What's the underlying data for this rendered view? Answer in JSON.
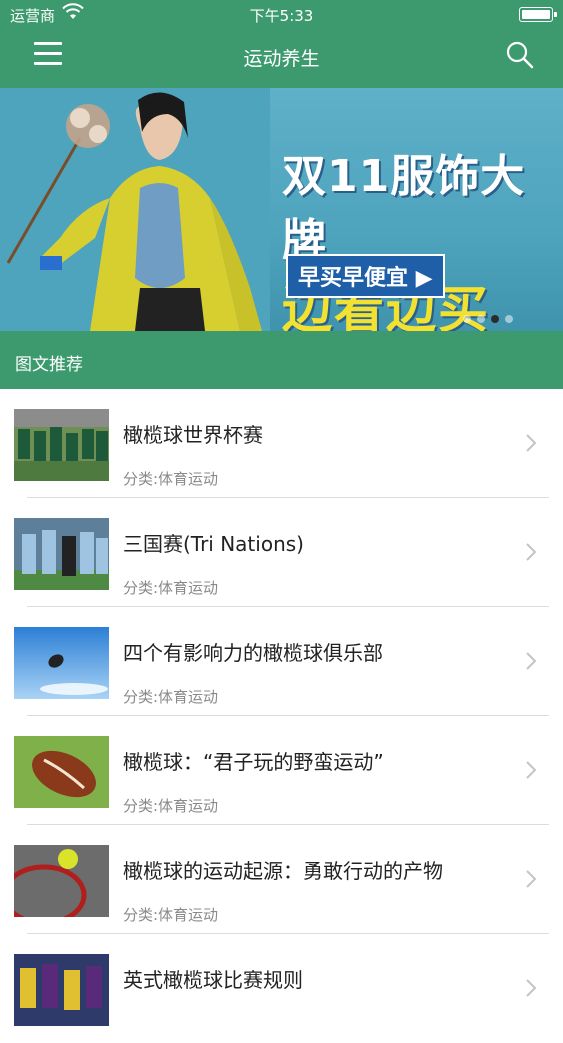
{
  "status_bar": {
    "carrier": "运营商",
    "time": "下午5:33"
  },
  "nav": {
    "title": "运动养生",
    "menu_icon": "menu-icon",
    "search_icon": "search-icon"
  },
  "banner": {
    "line1": "双11服饰大牌",
    "line2": "边看边买",
    "cta": "早买早便宜 ▶",
    "page_count": 4,
    "active_page": 3
  },
  "section": {
    "title": "图文推荐"
  },
  "articles": [
    {
      "title": "橄榄球世界杯赛",
      "category": "分类:体育运动"
    },
    {
      "title": "三国赛(Tri Nations)",
      "category": "分类:体育运动"
    },
    {
      "title": "四个有影响力的橄榄球俱乐部",
      "category": "分类:体育运动"
    },
    {
      "title": "橄榄球：“君子玩的野蛮运动”",
      "category": "分类:体育运动"
    },
    {
      "title": "橄榄球的运动起源：勇敢行动的产物",
      "category": "分类:体育运动"
    },
    {
      "title": "英式橄榄球比赛规则",
      "category": ""
    }
  ],
  "colors": {
    "primary": "#3d9a6f",
    "banner_bg": "#4ea3bd",
    "banner_accent": "#f3e132"
  }
}
